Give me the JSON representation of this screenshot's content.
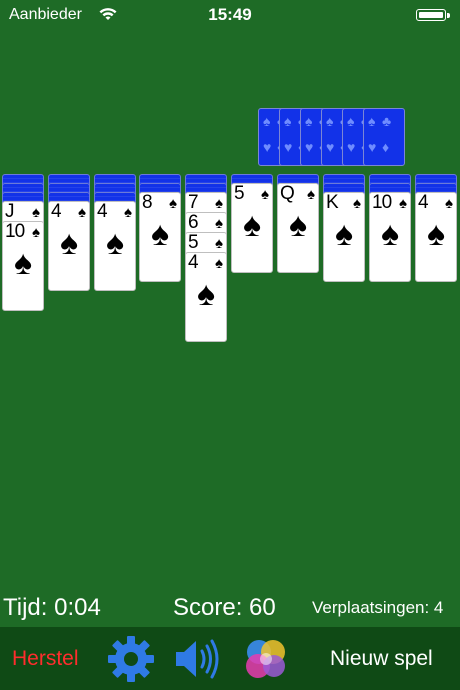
{
  "status_bar": {
    "carrier": "Aanbieder",
    "time": "15:49"
  },
  "colors": {
    "felt": "#1e6b26",
    "toolbar": "#0f4a15",
    "card_back": "#1232e8",
    "undo": "#ff2d2d"
  },
  "game": {
    "stock_piles": 6,
    "tableau": [
      {
        "face_down": 3,
        "face_up": [
          {
            "rank": "J",
            "suit": "♠"
          },
          {
            "rank": "10",
            "suit": "♠"
          }
        ]
      },
      {
        "face_down": 3,
        "face_up": [
          {
            "rank": "4",
            "suit": "♠"
          }
        ]
      },
      {
        "face_down": 3,
        "face_up": [
          {
            "rank": "4",
            "suit": "♠"
          }
        ]
      },
      {
        "face_down": 2,
        "face_up": [
          {
            "rank": "8",
            "suit": "♠"
          }
        ]
      },
      {
        "face_down": 2,
        "face_up": [
          {
            "rank": "7",
            "suit": "♠"
          },
          {
            "rank": "6",
            "suit": "♠"
          },
          {
            "rank": "5",
            "suit": "♠"
          },
          {
            "rank": "4",
            "suit": "♠"
          }
        ]
      },
      {
        "face_down": 1,
        "face_up": [
          {
            "rank": "5",
            "suit": "♠"
          }
        ]
      },
      {
        "face_down": 1,
        "face_up": [
          {
            "rank": "Q",
            "suit": "♠"
          }
        ]
      },
      {
        "face_down": 2,
        "face_up": [
          {
            "rank": "K",
            "suit": "♠"
          }
        ]
      },
      {
        "face_down": 2,
        "face_up": [
          {
            "rank": "10",
            "suit": "♠"
          }
        ]
      },
      {
        "face_down": 2,
        "face_up": [
          {
            "rank": "4",
            "suit": "♠"
          }
        ]
      }
    ]
  },
  "stats": {
    "time": "Tijd: 0:04",
    "score": "Score: 60",
    "moves": "Verplaatsingen: 4"
  },
  "toolbar": {
    "undo_label": "Herstel",
    "new_game_label": "Nieuw spel",
    "icons": [
      "gear-icon",
      "speaker-icon",
      "game-center-icon"
    ]
  }
}
